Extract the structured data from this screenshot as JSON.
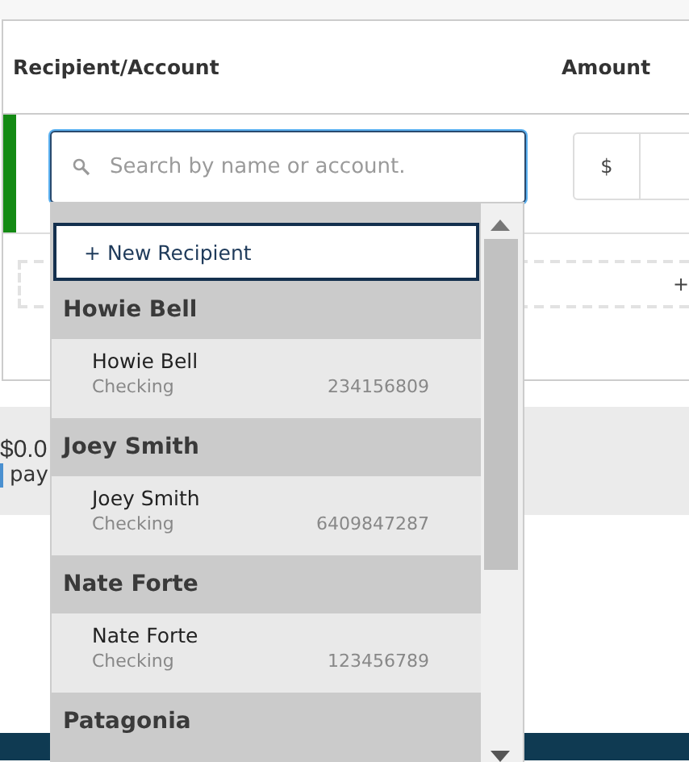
{
  "table": {
    "columns": [
      "Recipient/Account",
      "Amount"
    ],
    "row": {
      "search": {
        "placeholder": "Search by name or account."
      },
      "currency": "$",
      "add": "+"
    }
  },
  "summary": {
    "total": "$0.0",
    "note": "pay"
  },
  "dropdown": {
    "new_recipient": "+ New Recipient",
    "groups": [
      {
        "name": "Howie Bell",
        "accounts": [
          {
            "name": "Howie Bell",
            "type": "Checking",
            "number": "234156809"
          }
        ]
      },
      {
        "name": "Joey Smith",
        "accounts": [
          {
            "name": "Joey Smith",
            "type": "Checking",
            "number": "6409847287"
          }
        ]
      },
      {
        "name": "Nate Forte",
        "accounts": [
          {
            "name": "Nate Forte",
            "type": "Checking",
            "number": "123456789"
          }
        ]
      },
      {
        "name": "Patagonia"
      }
    ]
  }
}
